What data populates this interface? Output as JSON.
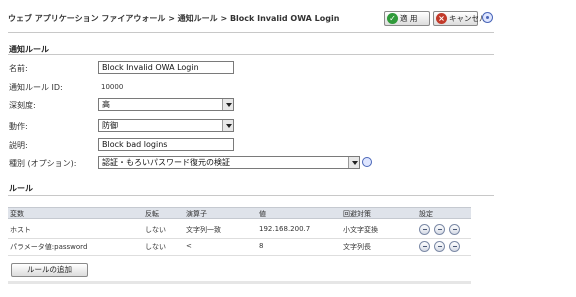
{
  "header": {
    "breadcrumb": "ウェブ アプリケーション ファイアウォール > 通知ルール > Block Invalid OWA Login",
    "apply_label": "適 用",
    "cancel_label": "キャンセル"
  },
  "rule_section": {
    "title": "通知ルール",
    "fields": {
      "name_label": "名前:",
      "name_value": "Block Invalid OWA Login",
      "id_label": "通知ルール ID:",
      "id_value": "10000",
      "severity_label": "深刻度:",
      "severity_value": "高",
      "action_label": "動作:",
      "action_value": "防御",
      "description_label": "説明:",
      "description_value": "Block bad logins",
      "category_label": "種別 (オプション):",
      "category_value": "認証・もろいパスワード復元の検証"
    }
  },
  "rules_section": {
    "title": "ルール",
    "columns": [
      "変数",
      "反転",
      "演算子",
      "値",
      "回避対策",
      "設定"
    ],
    "rows": [
      [
        "ホスト",
        "しない",
        "文字列一致",
        "192.168.200.7",
        "小文字変換"
      ],
      [
        "パラメータ値:password",
        "しない",
        "<",
        "8",
        "文字列長"
      ]
    ],
    "add_label": "ルールの追加"
  },
  "icons": {
    "apply": "check-icon",
    "cancel": "x-icon",
    "help": "help-icon",
    "edit": "pencil-icon",
    "delete": "delete-icon",
    "copy": "copy-icon"
  }
}
